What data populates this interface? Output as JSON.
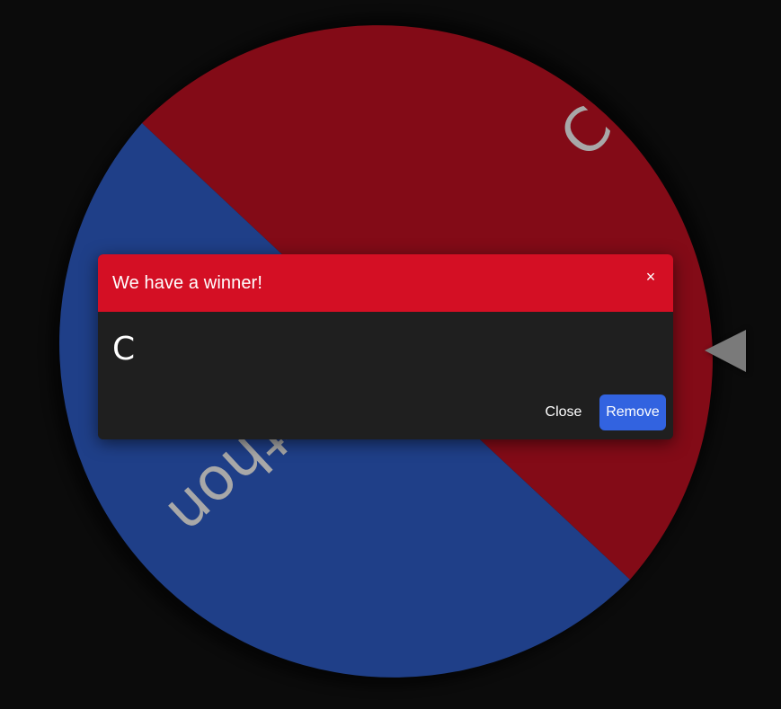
{
  "wheel": {
    "segments": [
      {
        "label": "C",
        "color": "#830b17"
      },
      {
        "label": "Python",
        "color": "#1f3f88"
      }
    ],
    "label_color": "#a8a8a8",
    "pointer_color": "#7a7a7a"
  },
  "dialog": {
    "title": "We have a winner!",
    "close_icon": "×",
    "winner": "C",
    "close_label": "Close",
    "remove_label": "Remove",
    "header_color": "#d40f24",
    "remove_color": "#3263e0"
  }
}
